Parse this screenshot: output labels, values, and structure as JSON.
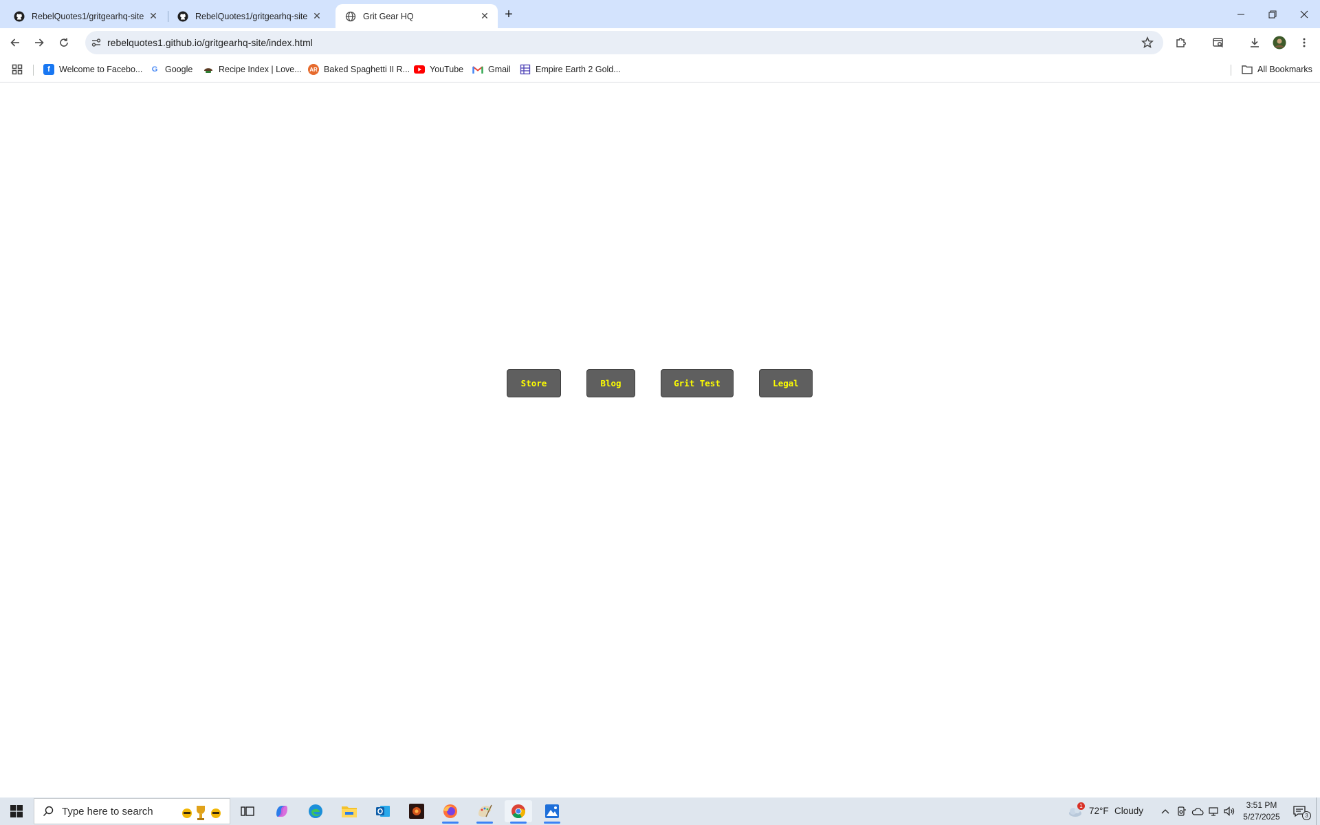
{
  "tabs": [
    {
      "title": "RebelQuotes1/gritgearhq-site",
      "icon": "github-icon"
    },
    {
      "title": "RebelQuotes1/gritgearhq-site",
      "icon": "github-icon"
    },
    {
      "title": "Grit Gear HQ",
      "icon": "globe-icon",
      "active": true
    }
  ],
  "address_bar": {
    "url": "rebelquotes1.github.io/gritgearhq-site/index.html"
  },
  "bookmarks": [
    {
      "label": "Welcome to Facebo...",
      "icon": "facebook-icon",
      "color": "#1877f2"
    },
    {
      "label": "Google",
      "icon": "google-icon",
      "color": "#4285f4"
    },
    {
      "label": "Recipe Index | Love...",
      "icon": "recipe-icon",
      "color": "#7a4b2a"
    },
    {
      "label": "Baked Spaghetti II R...",
      "icon": "allrecipes-icon",
      "color": "#e66a2c"
    },
    {
      "label": "YouTube",
      "icon": "youtube-icon",
      "color": "#ff0000"
    },
    {
      "label": "Gmail",
      "icon": "gmail-icon",
      "color": "#ea4335"
    },
    {
      "label": "Empire Earth 2 Gold...",
      "icon": "empire-earth-icon",
      "color": "#4b3fb5"
    }
  ],
  "all_bookmarks_label": "All Bookmarks",
  "page": {
    "nav_buttons": [
      {
        "label": "Store"
      },
      {
        "label": "Blog"
      },
      {
        "label": "Grit Test"
      },
      {
        "label": "Legal"
      }
    ],
    "button_bg": "#5f5f5f",
    "button_text_color": "#ffff00"
  },
  "taskbar": {
    "search_placeholder": "Type here to search",
    "weather": {
      "temp": "72°F",
      "condition": "Cloudy",
      "alert_count": "1"
    },
    "time": "3:51 PM",
    "date": "5/27/2025",
    "notification_count": "3"
  }
}
